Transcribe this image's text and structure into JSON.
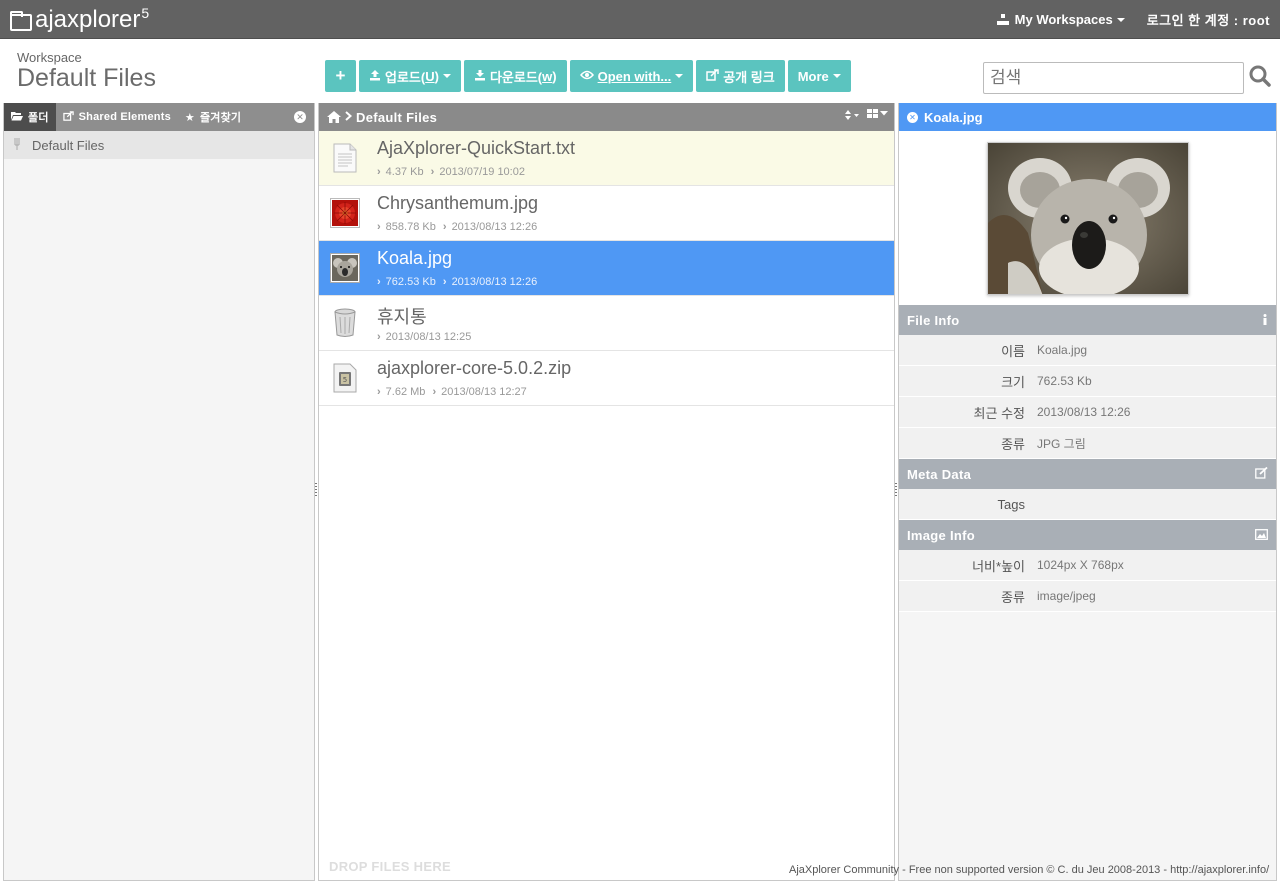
{
  "app": {
    "logo_text": "ajaxplorer",
    "logo_version": "5"
  },
  "topbar": {
    "workspaces_label": "My Workspaces",
    "login_label": "로그인 한 계정 : root"
  },
  "workspace": {
    "label": "Workspace",
    "title": "Default Files"
  },
  "toolbar": {
    "add_label": "+",
    "upload_label": "업로드(",
    "upload_key": "U",
    "upload_close": ")",
    "download_label": "다운로드(",
    "download_key": "w",
    "download_close": ")",
    "open_with_label": "Open with...",
    "share_label": "공개 링크",
    "more_label": "More"
  },
  "search": {
    "placeholder": "검색"
  },
  "left_panel": {
    "tabs": [
      {
        "label": "폴더"
      },
      {
        "label": "Shared Elements"
      },
      {
        "label": "즐겨찾기"
      }
    ],
    "tree": [
      {
        "label": "Default Files"
      }
    ]
  },
  "file_list": {
    "breadcrumb": "Default Files",
    "files": [
      {
        "name": "AjaXplorer-QuickStart.txt",
        "size": "4.37 Kb",
        "date": "2013/07/19 10:02",
        "icon": "text-file-icon"
      },
      {
        "name": "Chrysanthemum.jpg",
        "size": "858.78 Kb",
        "date": "2013/08/13 12:26",
        "icon": "image-thumb"
      },
      {
        "name": "Koala.jpg",
        "size": "762.53 Kb",
        "date": "2013/08/13 12:26",
        "icon": "image-thumb"
      },
      {
        "name": "휴지통",
        "date": "2013/08/13 12:25",
        "icon": "trash-icon"
      },
      {
        "name": "ajaxplorer-core-5.0.2.zip",
        "size": "7.62 Mb",
        "date": "2013/08/13 12:27",
        "icon": "zip-icon"
      }
    ],
    "drop_label": "DROP FILES HERE"
  },
  "details": {
    "title": "Koala.jpg",
    "file_info": {
      "heading": "File Info",
      "rows": [
        {
          "key": "이름",
          "value": "Koala.jpg"
        },
        {
          "key": "크기",
          "value": "762.53 Kb"
        },
        {
          "key": "최근 수정",
          "value": "2013/08/13 12:26"
        },
        {
          "key": "종류",
          "value": "JPG 그림"
        }
      ]
    },
    "meta_data": {
      "heading": "Meta Data",
      "rows": [
        {
          "key": "Tags",
          "value": ""
        }
      ]
    },
    "image_info": {
      "heading": "Image Info",
      "rows": [
        {
          "key": "너비*높이",
          "value": "1024px X 768px"
        },
        {
          "key": "종류",
          "value": "image/jpeg"
        }
      ]
    }
  },
  "footer": {
    "text": "AjaXplorer Community - Free non supported version © C. du Jeu 2008-2013 - http://ajaxplorer.info/"
  },
  "colors": {
    "accent": "#5bc4bf",
    "selection": "#4f98f4",
    "topbar": "#626262"
  }
}
